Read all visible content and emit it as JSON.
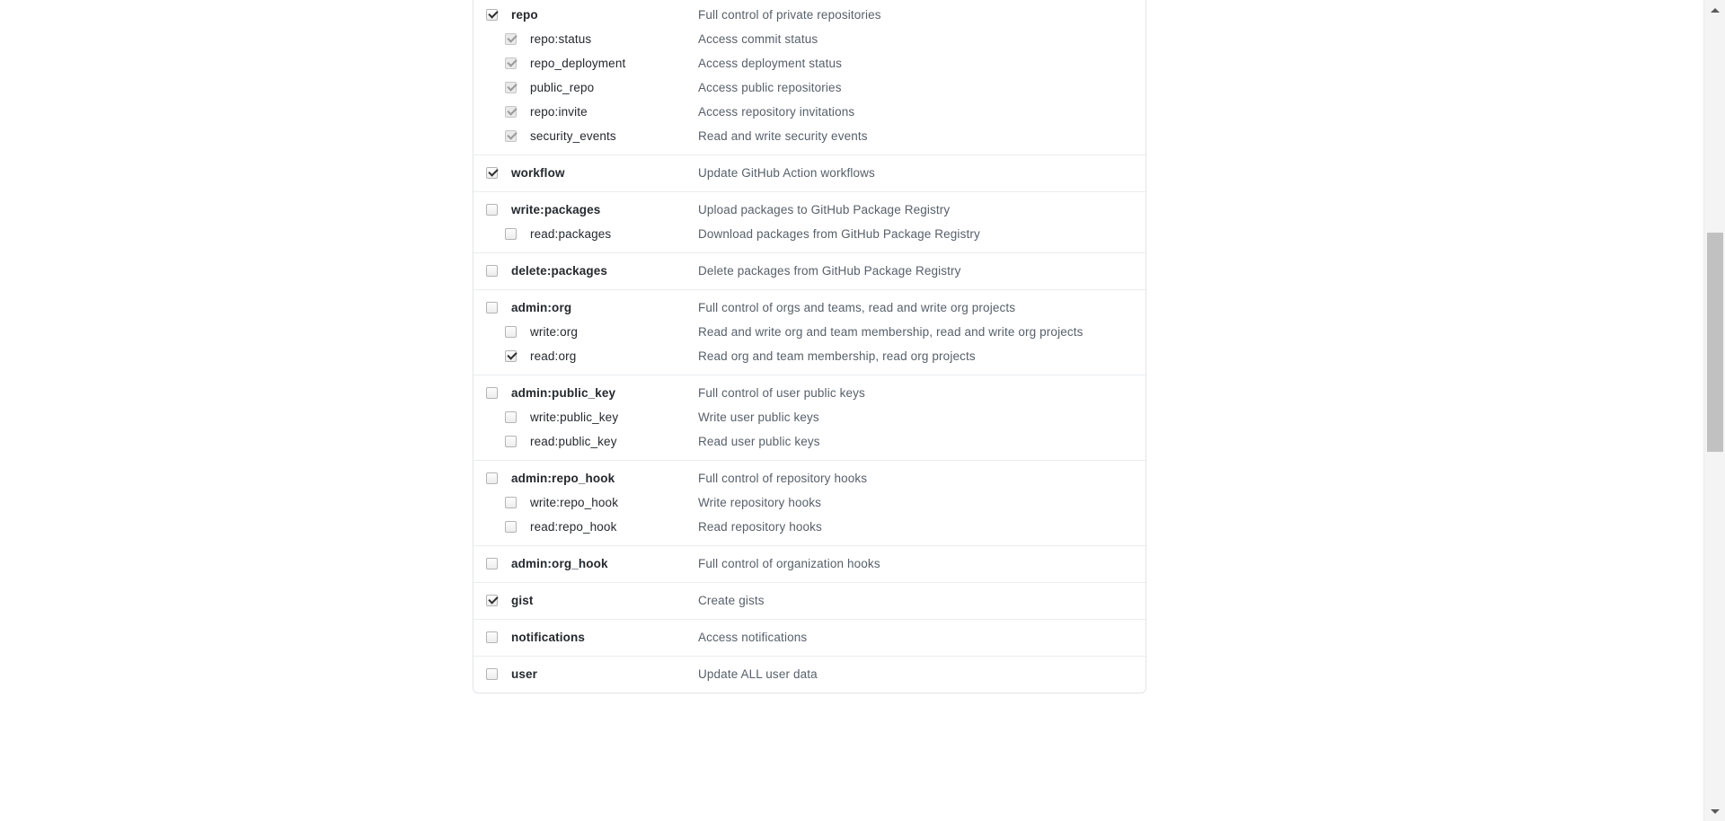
{
  "window": {
    "scrollbar": {
      "up_arrow": "▲",
      "down_arrow": "▼"
    }
  },
  "scope_list": {
    "groups": [
      {
        "rows": [
          {
            "level": "parent",
            "name": "repo",
            "description": "Full control of private repositories",
            "checked": true,
            "disabled": false
          },
          {
            "level": "child",
            "name": "repo:status",
            "description": "Access commit status",
            "checked": true,
            "disabled": true
          },
          {
            "level": "child",
            "name": "repo_deployment",
            "description": "Access deployment status",
            "checked": true,
            "disabled": true
          },
          {
            "level": "child",
            "name": "public_repo",
            "description": "Access public repositories",
            "checked": true,
            "disabled": true
          },
          {
            "level": "child",
            "name": "repo:invite",
            "description": "Access repository invitations",
            "checked": true,
            "disabled": true
          },
          {
            "level": "child",
            "name": "security_events",
            "description": "Read and write security events",
            "checked": true,
            "disabled": true
          }
        ]
      },
      {
        "rows": [
          {
            "level": "parent",
            "name": "workflow",
            "description": "Update GitHub Action workflows",
            "checked": true,
            "disabled": false
          }
        ]
      },
      {
        "rows": [
          {
            "level": "parent",
            "name": "write:packages",
            "description": "Upload packages to GitHub Package Registry",
            "checked": false,
            "disabled": false
          },
          {
            "level": "child",
            "name": "read:packages",
            "description": "Download packages from GitHub Package Registry",
            "checked": false,
            "disabled": false
          }
        ]
      },
      {
        "rows": [
          {
            "level": "parent",
            "name": "delete:packages",
            "description": "Delete packages from GitHub Package Registry",
            "checked": false,
            "disabled": false
          }
        ]
      },
      {
        "rows": [
          {
            "level": "parent",
            "name": "admin:org",
            "description": "Full control of orgs and teams, read and write org projects",
            "checked": false,
            "disabled": false
          },
          {
            "level": "child",
            "name": "write:org",
            "description": "Read and write org and team membership, read and write org projects",
            "checked": false,
            "disabled": false
          },
          {
            "level": "child",
            "name": "read:org",
            "description": "Read org and team membership, read org projects",
            "checked": true,
            "disabled": false
          }
        ]
      },
      {
        "rows": [
          {
            "level": "parent",
            "name": "admin:public_key",
            "description": "Full control of user public keys",
            "checked": false,
            "disabled": false
          },
          {
            "level": "child",
            "name": "write:public_key",
            "description": "Write user public keys",
            "checked": false,
            "disabled": false
          },
          {
            "level": "child",
            "name": "read:public_key",
            "description": "Read user public keys",
            "checked": false,
            "disabled": false
          }
        ]
      },
      {
        "rows": [
          {
            "level": "parent",
            "name": "admin:repo_hook",
            "description": "Full control of repository hooks",
            "checked": false,
            "disabled": false
          },
          {
            "level": "child",
            "name": "write:repo_hook",
            "description": "Write repository hooks",
            "checked": false,
            "disabled": false
          },
          {
            "level": "child",
            "name": "read:repo_hook",
            "description": "Read repository hooks",
            "checked": false,
            "disabled": false
          }
        ]
      },
      {
        "rows": [
          {
            "level": "parent",
            "name": "admin:org_hook",
            "description": "Full control of organization hooks",
            "checked": false,
            "disabled": false
          }
        ]
      },
      {
        "rows": [
          {
            "level": "parent",
            "name": "gist",
            "description": "Create gists",
            "checked": true,
            "disabled": false
          }
        ]
      },
      {
        "rows": [
          {
            "level": "parent",
            "name": "notifications",
            "description": "Access notifications",
            "checked": false,
            "disabled": false
          }
        ]
      },
      {
        "rows": [
          {
            "level": "parent",
            "name": "user",
            "description": "Update ALL user data",
            "checked": false,
            "disabled": false
          }
        ]
      }
    ]
  }
}
